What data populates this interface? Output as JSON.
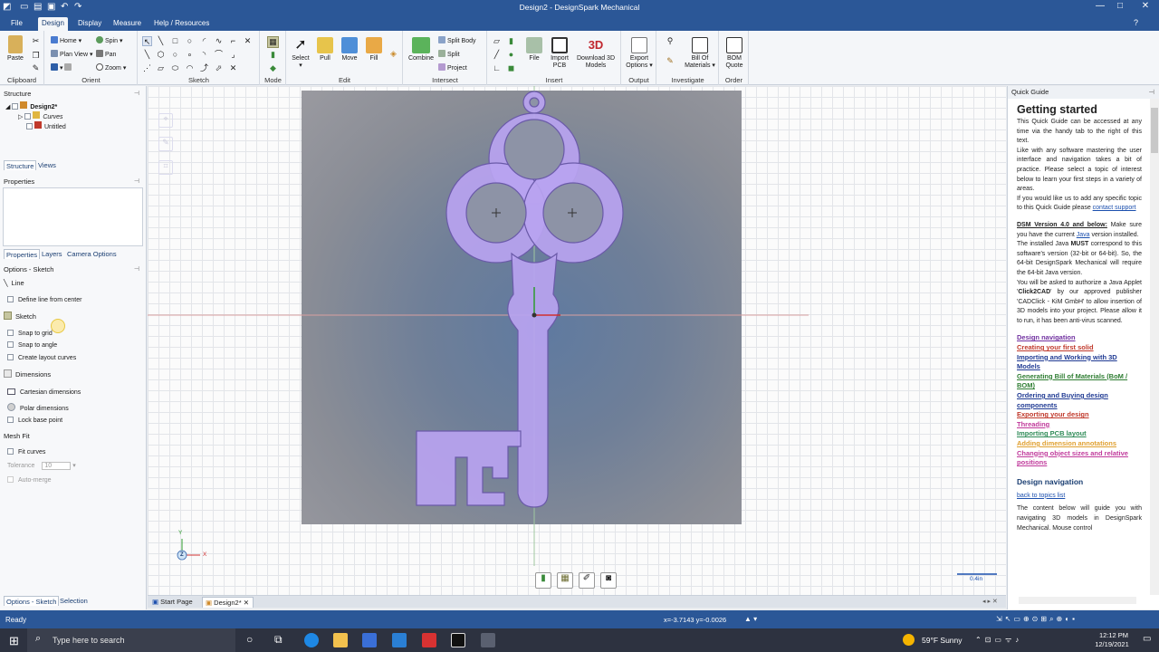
{
  "window": {
    "title": "Design2 - DesignSpark Mechanical"
  },
  "menu": {
    "tabs": [
      "File",
      "Design",
      "Display",
      "Measure",
      "Help / Resources"
    ],
    "active": "Design"
  },
  "ribbon": {
    "clipboard": {
      "paste": "Paste",
      "label": "Clipboard"
    },
    "orient": {
      "home": "Home",
      "spin": "Spin",
      "plan_view": "Plan View",
      "pan": "Pan",
      "zoom": "Zoom",
      "label": "Orient"
    },
    "sketch": {
      "label": "Sketch"
    },
    "mode": {
      "label": "Mode"
    },
    "edit": {
      "select": "Select",
      "pull": "Pull",
      "move": "Move",
      "fill": "Fill",
      "label": "Edit"
    },
    "intersect": {
      "combine": "Combine",
      "split_body": "Split Body",
      "split": "Split",
      "project": "Project",
      "label": "Intersect"
    },
    "insert": {
      "file": "File",
      "import_pcb": "Import\nPCB",
      "download_3d": "Download 3D\nModels",
      "label": "Insert"
    },
    "output": {
      "export_options": "Export\nOptions",
      "label": "Output"
    },
    "investigate": {
      "bom": "Bill Of\nMaterials",
      "label": "Investigate"
    },
    "order": {
      "bom_quote": "BOM\nQuote",
      "label": "Order"
    }
  },
  "structure": {
    "header": "Structure",
    "tree": [
      {
        "label": "Design2*",
        "bold": true
      },
      {
        "label": "Curves",
        "italic": true
      },
      {
        "label": "Untitled"
      }
    ],
    "tabs": [
      "Structure",
      "Views"
    ]
  },
  "properties": {
    "header": "Properties",
    "tabs": [
      "Properties",
      "Layers",
      "Camera Options"
    ]
  },
  "options": {
    "header": "Options - Sketch",
    "line_section": "Line",
    "define_line_from_center": "Define line from center",
    "sketch_section": "Sketch",
    "snap_to_grid": "Snap to grid",
    "snap_to_angle": "Snap to angle",
    "create_layout_curves": "Create layout curves",
    "dimensions_section": "Dimensions",
    "cartesian_dimensions": "Cartesian dimensions",
    "polar_dimensions": "Polar dimensions",
    "lock_base_point": "Lock base point",
    "mesh_fit_section": "Mesh Fit",
    "fit_curves": "Fit curves",
    "tolerance_label": "Tolerance",
    "tolerance_value": "10",
    "auto_merge": "Auto-merge",
    "bottom_tabs": [
      "Options - Sketch",
      "Selection"
    ]
  },
  "document_tabs": [
    "Start Page",
    "Design2*"
  ],
  "canvas": {
    "scale_label": "0.4in",
    "axis_x": "X",
    "axis_y": "Y",
    "axis_z": "Z"
  },
  "guide": {
    "header": "Quick Guide",
    "title": "Getting started",
    "p1": "This Quick Guide can be accessed at any time via the handy tab to the right of this text.",
    "p2": "Like with any software mastering the user interface and navigation takes a bit of practice. Please select a topic of interest below to learn your first steps in a variety of areas.",
    "p3_prefix": "If you would like us to add any specific topic to this Quick Guide please ",
    "p3_link": "contact support",
    "dsm_heading": "DSM Version 4.0 and below:",
    "dsm_text1": " Make sure you have the current ",
    "java_link": "Java",
    "dsm_text2": " version installed.",
    "p5_prefix": "The installed Java ",
    "p5_must": "MUST",
    "p5_suffix": " correspond to this software's version (32-bit or 64-bit). So, the 64-bit DesignSpark Mechanical will require the 64-bit Java version.",
    "p6_prefix": "You will be asked to authorize a Java Applet '",
    "p6_bold": "Click2CAD",
    "p6_suffix": "' by our approved publisher 'CADClick - KiM GmbH' to allow insertion of 3D models into your project. Please allow it to run, it has been anti-virus scanned.",
    "topics": [
      {
        "label": "Design navigation",
        "color": "#7030a0"
      },
      {
        "label": "Creating your first solid",
        "color": "#c0392b"
      },
      {
        "label": "Importing and Working with 3D Models",
        "color": "#1f3a93"
      },
      {
        "label": "Generating Bill of Materials (BoM / BOM)",
        "color": "#2e7d32"
      },
      {
        "label": "Ordering and Buying design components",
        "color": "#1f3a93"
      },
      {
        "label": "Exporting your design",
        "color": "#c0392b"
      },
      {
        "label": "Threading",
        "color": "#c0399b"
      },
      {
        "label": "Importing PCB layout",
        "color": "#2e8b57"
      },
      {
        "label": "Adding dimension annotations",
        "color": "#e0a030"
      },
      {
        "label": "Changing object sizes and relative positions",
        "color": "#c0399b"
      }
    ],
    "nav_heading": "Design navigation",
    "back_link": "back to topics list",
    "nav_text": "The content below will guide you with navigating 3D models in DesignSpark Mechanical. Mouse control"
  },
  "status": {
    "ready": "Ready",
    "coords": "x=-3.7143  y=-0.0026"
  },
  "taskbar": {
    "search_placeholder": "Type here to search",
    "weather": "59°F  Sunny",
    "time": "12:12 PM",
    "date": "12/19/2021"
  },
  "colors": {
    "titlebar": "#2b5797",
    "ribbon_bg": "#f4f6f9",
    "key_fill": "#b9a3f0",
    "key_stroke": "#6a5aa8"
  }
}
